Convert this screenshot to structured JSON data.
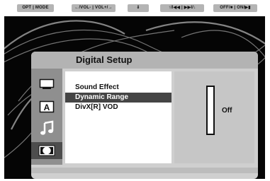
{
  "remote_hints": [
    "OPT | MODE",
    "←/VOL- | VOL+/→",
    "⇓",
    "↑/I◀◀ | ▶▶I/↓",
    "OFF/■ | ON/▶▮"
  ],
  "menu": {
    "title": "Digital  Setup",
    "items": [
      "Sound Effect",
      "Dynamic Range",
      "DivX[R]  VOD"
    ],
    "selected_index": 1
  },
  "sidebar_icons": [
    "monitor-icon",
    "subtitle-a-icon",
    "music-note-icon",
    "dolby-digital-icon"
  ],
  "value_panel": {
    "value": "Off"
  },
  "colors": {
    "background": "#050505",
    "panel": "#cfcfcf",
    "selection": "#454545"
  }
}
